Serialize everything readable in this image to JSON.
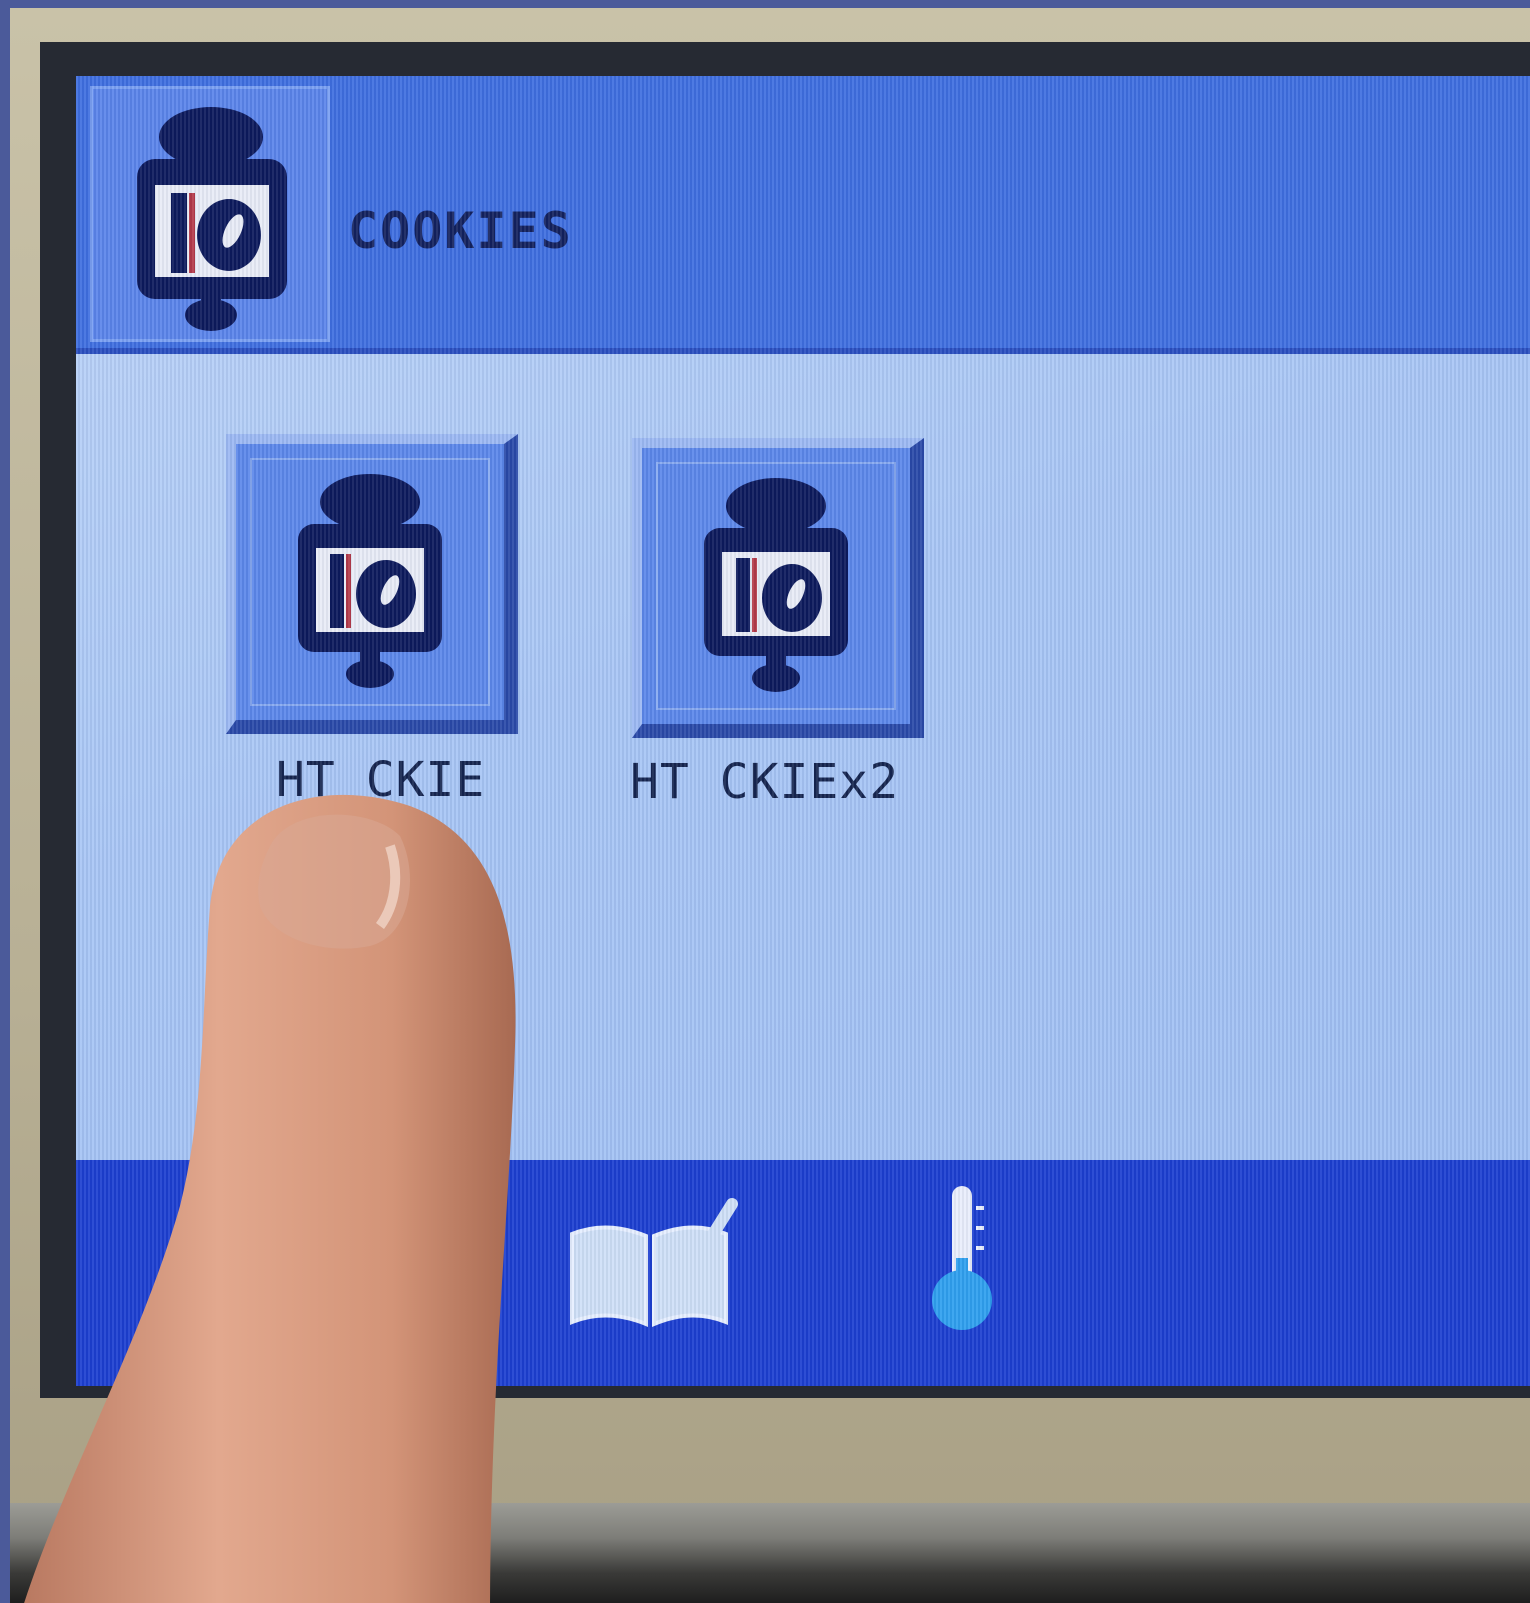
{
  "header": {
    "title": "COOKIES",
    "icon": "cookie-recipe-icon"
  },
  "recipes": [
    {
      "label": "HT CKIE",
      "icon": "cookie-recipe-icon"
    },
    {
      "label": "HT CKIEx2",
      "icon": "cookie-recipe-icon"
    }
  ],
  "footer": {
    "buttons": [
      {
        "icon": "recipe-book-edit-icon"
      },
      {
        "icon": "thermometer-icon"
      }
    ]
  },
  "colors": {
    "header_bg": "#3f6fe0",
    "body_bg": "#a8c6f5",
    "footer_bg": "#1c3fd0",
    "icon_dark": "#0d1a5c"
  }
}
